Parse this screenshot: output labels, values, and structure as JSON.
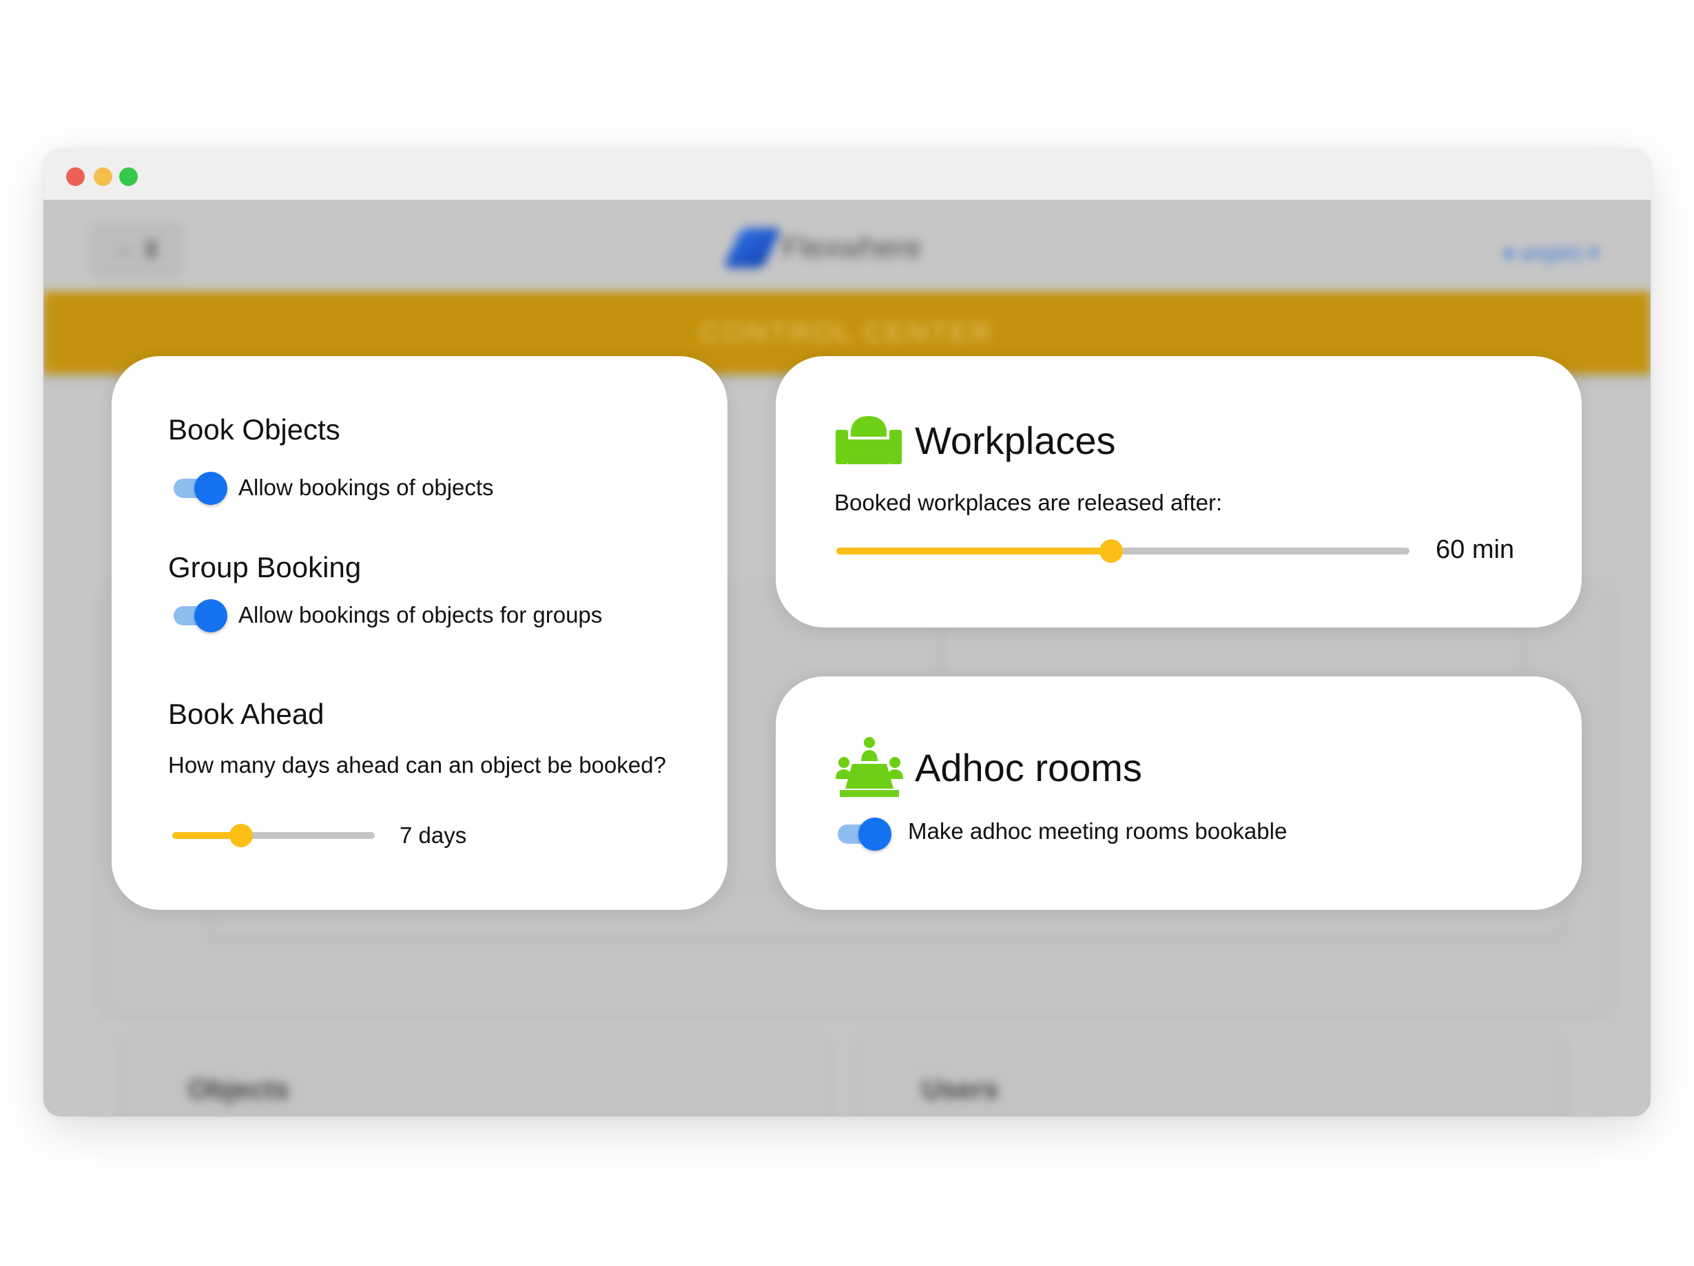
{
  "app": {
    "logo_text": "Flexwhere",
    "user_label": "● angelo ▾",
    "control_center": "CONTROL CENTER",
    "bg_panel_objects": "Objects",
    "bg_panel_users": "Users"
  },
  "book_objects": {
    "title": "Book Objects",
    "toggle_label": "Allow bookings of objects",
    "enabled": true
  },
  "group_booking": {
    "title": "Group Booking",
    "toggle_label": "Allow bookings of objects for groups",
    "enabled": true
  },
  "book_ahead": {
    "title": "Book Ahead",
    "question": "How many days ahead can an object be booked?",
    "value_label": "7 days",
    "slider_fraction": 0.34
  },
  "workplaces": {
    "title": "Workplaces",
    "description": "Booked workplaces are released after:",
    "value_label": "60 min",
    "slider_fraction": 0.48,
    "icon": "armchair-icon",
    "icon_color": "#6ed016"
  },
  "adhoc_rooms": {
    "title": "Adhoc rooms",
    "toggle_label": "Make adhoc meeting rooms bookable",
    "enabled": true,
    "icon": "meeting-room-icon",
    "icon_color": "#6ed016"
  },
  "colors": {
    "toggle_blue": "#1472f0",
    "slider_yellow": "#fbbf18",
    "header_bar": "#c4920d"
  }
}
